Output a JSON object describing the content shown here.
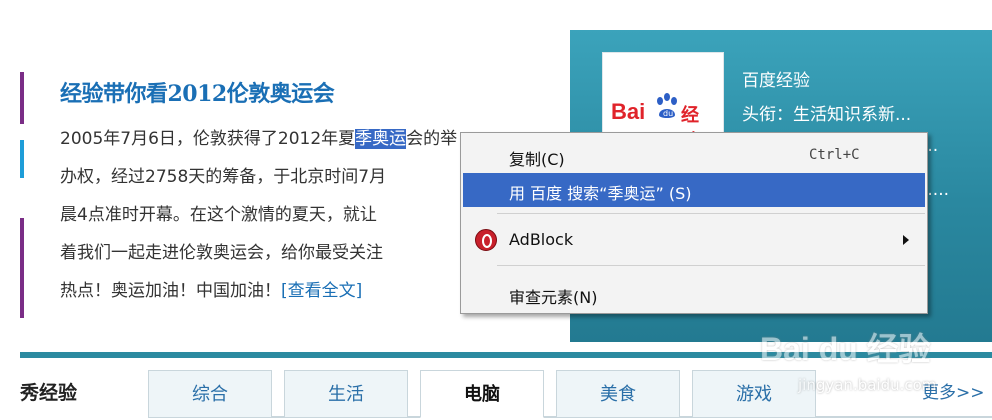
{
  "article": {
    "title": "经验带你看2012伦敦奥运会",
    "lines": [
      {
        "pre": "2005年7月6日，伦敦获得了2012年夏",
        "selected": "季奥运",
        "post": "会的举"
      },
      {
        "pre": "办权，经过2758天的筹备，于北京时间7月"
      },
      {
        "pre": "晨4点准时开幕。在这个激情的夏天，就让"
      },
      {
        "pre": "着我们一起走进伦敦奥运会，给你最受关注"
      },
      {
        "pre": "热点！奥运加油！中国加油！",
        "link": "[查看全文]"
      }
    ]
  },
  "sidebar_card": {
    "logo_text_left": "Bai",
    "logo_text_right": "经验",
    "name": "百度经验",
    "subtitle": "头衔：生活知识系新...",
    "ellipsis_1": "...",
    "ellipsis_2": "....."
  },
  "context_menu": {
    "items": [
      {
        "label": "复制(C)",
        "shortcut": "Ctrl+C",
        "highlighted": false
      },
      {
        "label": "用 百度 搜索“季奥运” (S)",
        "highlighted": true
      },
      {
        "label": "AdBlock",
        "has_submenu": true,
        "icon": "adblock-icon"
      },
      {
        "label": "审查元素(N)"
      }
    ]
  },
  "tabs": {
    "section_title": "秀经验",
    "items": [
      "综合",
      "生活",
      "电脑",
      "美食",
      "游戏"
    ],
    "active": "电脑",
    "more": "更多>>"
  },
  "watermark": {
    "logo": "Bai du 经验",
    "url": "jingyan.baidu.com"
  },
  "colors": {
    "accent_teal": "#2b8aa0",
    "selection_blue": "#3769c5",
    "title_blue": "#1a6fb5",
    "brand_red": "#e0232a"
  }
}
